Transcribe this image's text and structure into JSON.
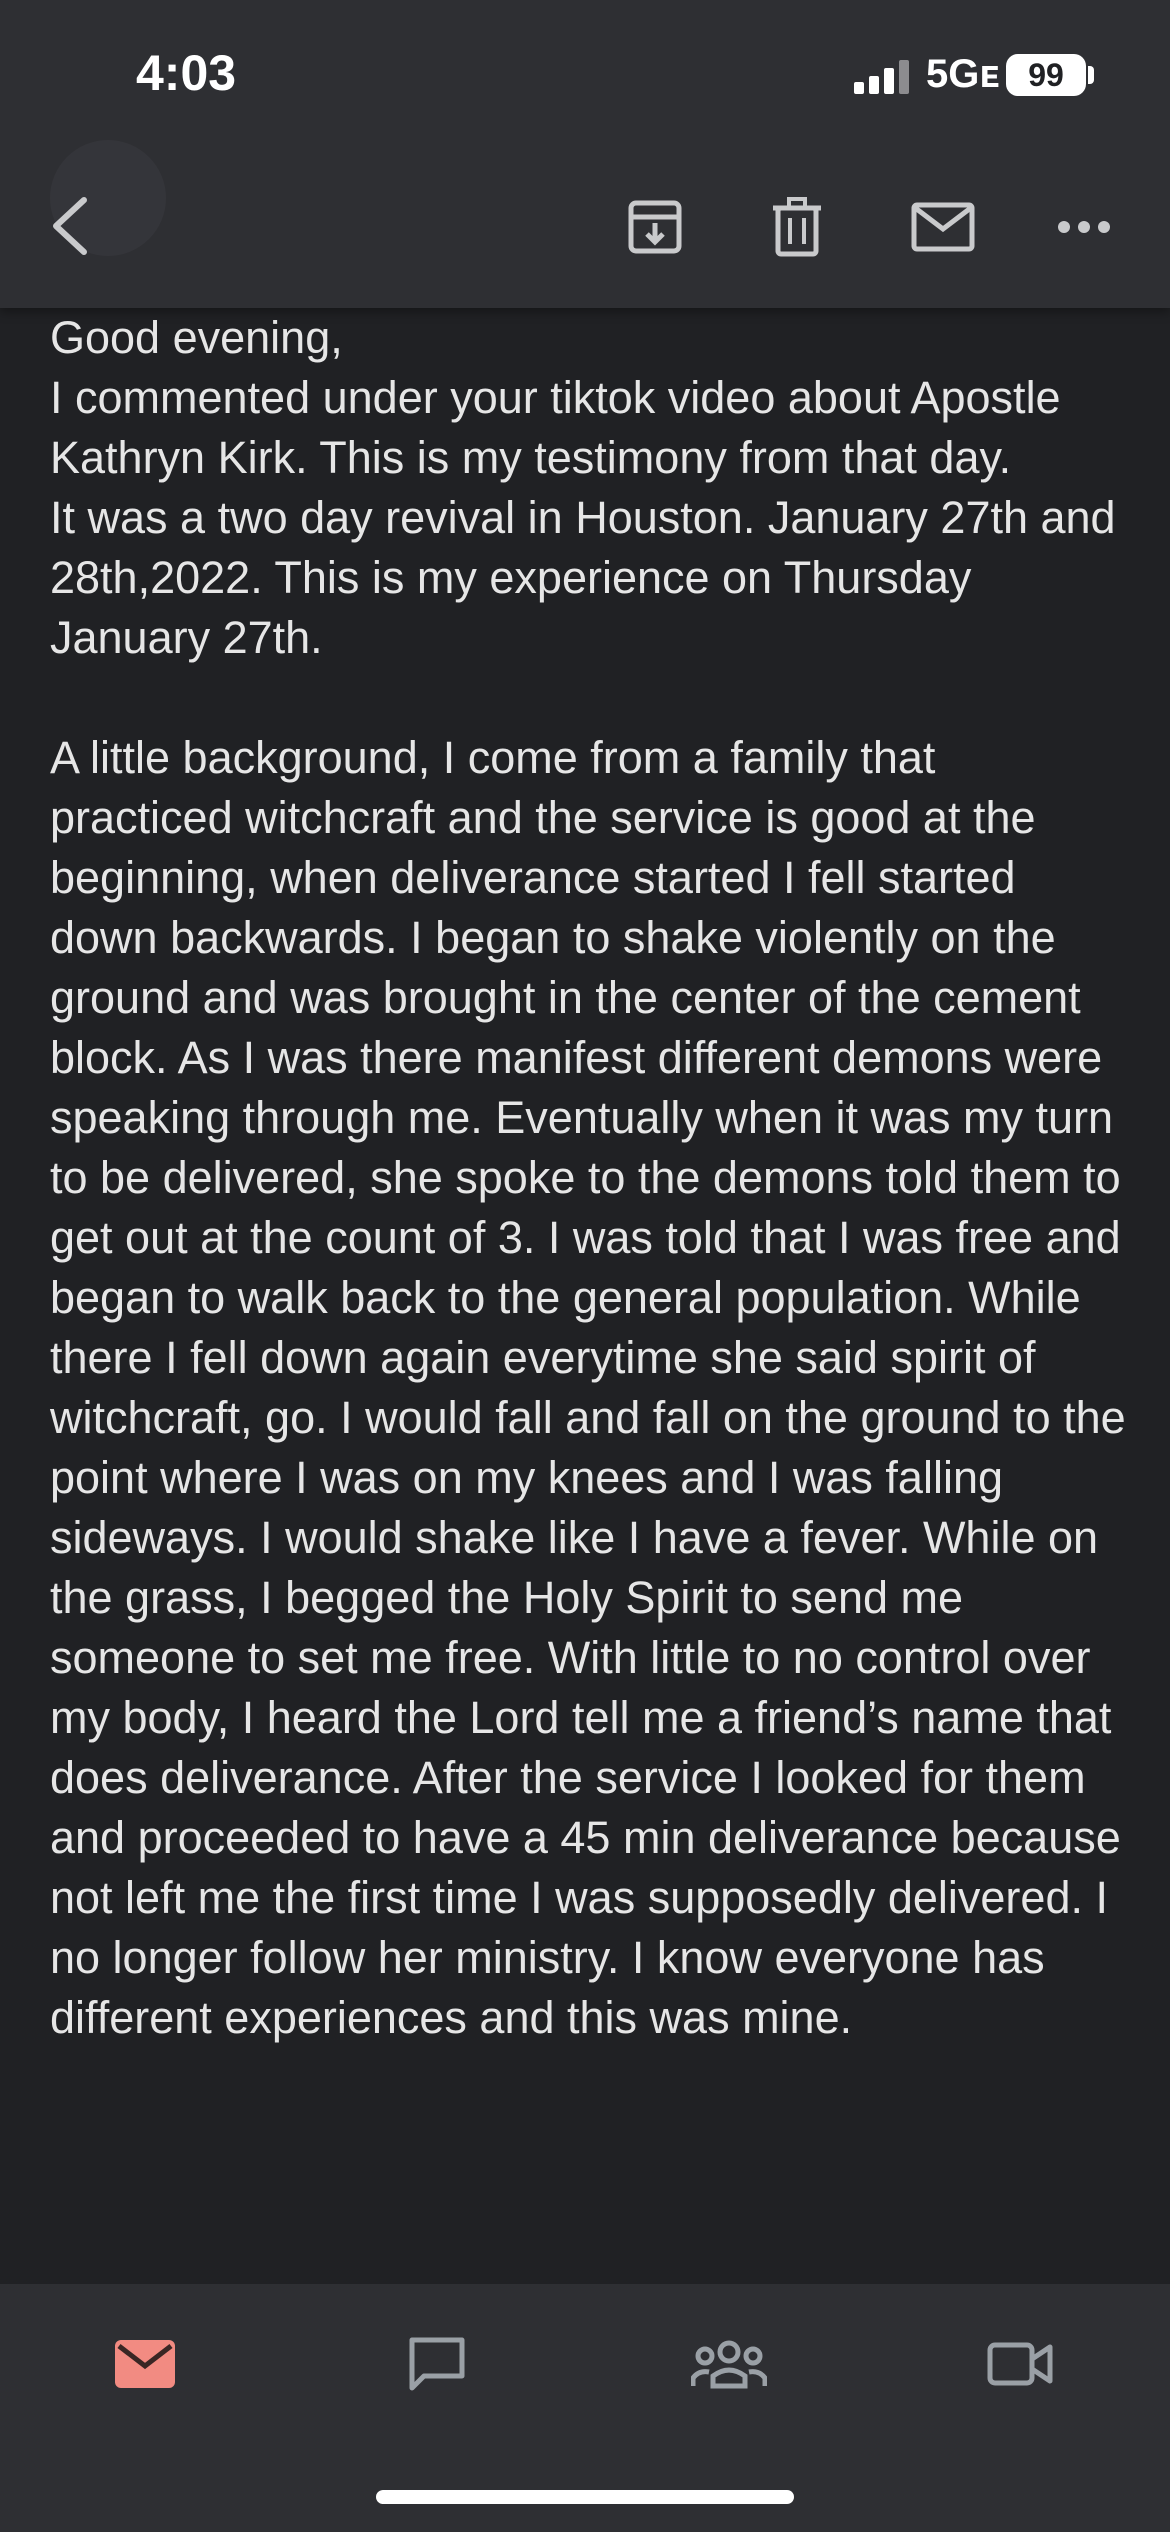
{
  "status_bar": {
    "time": "4:03",
    "network": "5Gᴇ",
    "battery": "99"
  },
  "toolbar": {
    "icons": [
      "back-icon",
      "archive-icon",
      "trash-icon",
      "mail-icon",
      "more-icon"
    ]
  },
  "email": {
    "paragraphs": [
      "Good evening,\nI commented under your tiktok video about Apostle Kathryn Kirk. This is my testimony from that day.\nIt was a two day revival in Houston. January 27th and 28th,2022. This is my experience on Thursday January 27th.",
      "A little background, I come from a family that practiced witchcraft and the service is good at the beginning, when deliverance started I fell started down backwards. I began to shake violently on the ground and was brought in the center of the cement block. As I was there manifest different demons were speaking through me. Eventually when it was my turn to be delivered, she spoke to the demons told them to get out at the count of 3. I was told that I was free and began to walk back to the general population. While there I fell down again everytime she said spirit of witchcraft, go. I would fall and fall on the ground to the point where I was on my knees and I was falling sideways. I would shake like I have a fever. While on the grass, I begged the Holy Spirit to send me someone to set me free. With little to no control over my body, I heard the Lord tell me a friend’s name that does deliverance. After the service I looked for them and proceeded to have a 45 min deliverance because not left me the first time I was supposedly delivered. I no longer follow her ministry. I know everyone has different experiences and this was mine."
    ]
  },
  "bottom_nav": {
    "items": [
      "mail-icon",
      "chat-icon",
      "spaces-icon",
      "meet-icon"
    ],
    "active_color": "#f28b82",
    "inactive_color": "#9aa0a6"
  }
}
